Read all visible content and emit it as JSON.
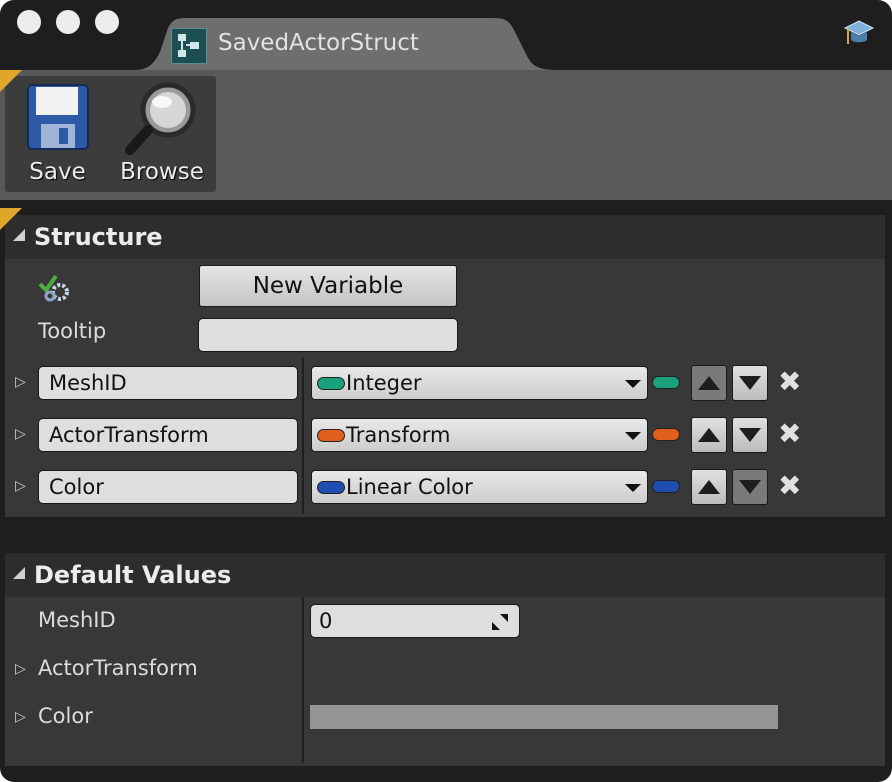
{
  "window": {
    "tab_title": "SavedActorStruct",
    "tab_close": "×"
  },
  "toolbar": {
    "save_label": "Save",
    "browse_label": "Browse"
  },
  "structure": {
    "header": "Structure",
    "new_variable_label": "New Variable",
    "tooltip_label": "Tooltip",
    "tooltip_value": "",
    "variables": [
      {
        "name": "MeshID",
        "type": "Integer",
        "color": "#1ba07c",
        "up_enabled": false,
        "down_enabled": true
      },
      {
        "name": "ActorTransform",
        "type": "Transform",
        "color": "#e0601b",
        "up_enabled": true,
        "down_enabled": true
      },
      {
        "name": "Color",
        "type": "Linear Color",
        "color": "#1e4fb0",
        "up_enabled": true,
        "down_enabled": false
      }
    ],
    "remove_glyph": "✖"
  },
  "defaults": {
    "header": "Default Values",
    "mesh_id_label": "MeshID",
    "mesh_id_value": "0",
    "actor_transform_label": "ActorTransform",
    "color_label": "Color",
    "color_swatch": "#959595"
  },
  "colors": {
    "accent_corner": "#e0a62a",
    "panel_bg": "#383838",
    "header_bg": "#2d2d2d"
  }
}
